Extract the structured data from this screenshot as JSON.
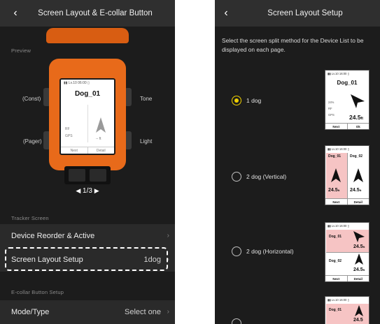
{
  "left": {
    "header": {
      "back_icon": "chevron-left-icon",
      "back_glyph": "‹",
      "title": "Screen Layout & E-collar Button"
    },
    "preview": {
      "section_label": "Preview",
      "labels": {
        "const": "(Const)",
        "tone": "Tone",
        "pager": "(Pager)",
        "light": "Light"
      },
      "device_screen": {
        "status": "▮▮ Lv.10  06:00 ▯",
        "dog_name": "Dog_01",
        "rf": "RF",
        "gps": "GPS",
        "distance": "-- ft",
        "softkey_left": "Next",
        "softkey_right": "Detail"
      },
      "pager": {
        "prev_icon": "triangle-left-icon",
        "prev_glyph": "◀",
        "current": "1",
        "separator": "/",
        "total": "3",
        "next_icon": "triangle-right-icon",
        "next_glyph": "▶"
      }
    },
    "tracker_section": {
      "label": "Tracker Screen",
      "items": [
        {
          "label": "Device Reorder & Active",
          "value": "",
          "chevron": "›"
        },
        {
          "label": "Screen Layout Setup",
          "value": "1dog",
          "chevron": "›"
        }
      ]
    },
    "ecollar_section": {
      "label": "E-collar Button Setup",
      "items": [
        {
          "label": "Mode/Type",
          "value": "Select one",
          "chevron": "›"
        }
      ]
    },
    "colors": {
      "accent_orange": "#e86a1a",
      "background": "#1c1c1c",
      "row": "#2a2a2a"
    }
  },
  "right": {
    "header": {
      "back_icon": "chevron-left-icon",
      "back_glyph": "‹",
      "title": "Screen Layout Setup"
    },
    "instructions": "Select the screen split method for the Device List to be displayed on each page.",
    "options": [
      {
        "label": "1 dog",
        "selected": true
      },
      {
        "label": "2 dog (Vertical)",
        "selected": false
      },
      {
        "label": "2 dog (Horizontal)",
        "selected": false
      }
    ],
    "thumbnails": {
      "one_dog": {
        "status": "▮▮ Lv.10  16:00 ▯",
        "dog": "Dog_01",
        "battery": "24%",
        "rf": "RF",
        "gps": "GPS",
        "distance": "24.5",
        "unit": "ft",
        "key_left": "Next",
        "key_right": "Ok"
      },
      "two_vertical": {
        "status": "▮▮ Lv.10  16:00 ▯",
        "dog_a": "Dog_01",
        "dog_b": "Dog_02",
        "dist_a": "24.5",
        "dist_b": "24.5",
        "unit": "ft",
        "key_left": "Next",
        "key_right": "Detail"
      },
      "two_horizontal": {
        "status": "▮▮ Lv.10  16:00 ▯",
        "dog_a": "Dog_01",
        "dog_b": "Dog_02",
        "dist_a": "24.5",
        "dist_b": "24.5",
        "unit": "ft",
        "key_left": "Next",
        "key_right": "Detail"
      },
      "partial": {
        "status": "▮▮ Lv.10  16:00 ▯",
        "dog_a": "Dog_01",
        "dist_a": "24.5"
      }
    },
    "colors": {
      "radio_selected": "#f0d000",
      "pane_highlight": "#f6c4c4"
    }
  }
}
